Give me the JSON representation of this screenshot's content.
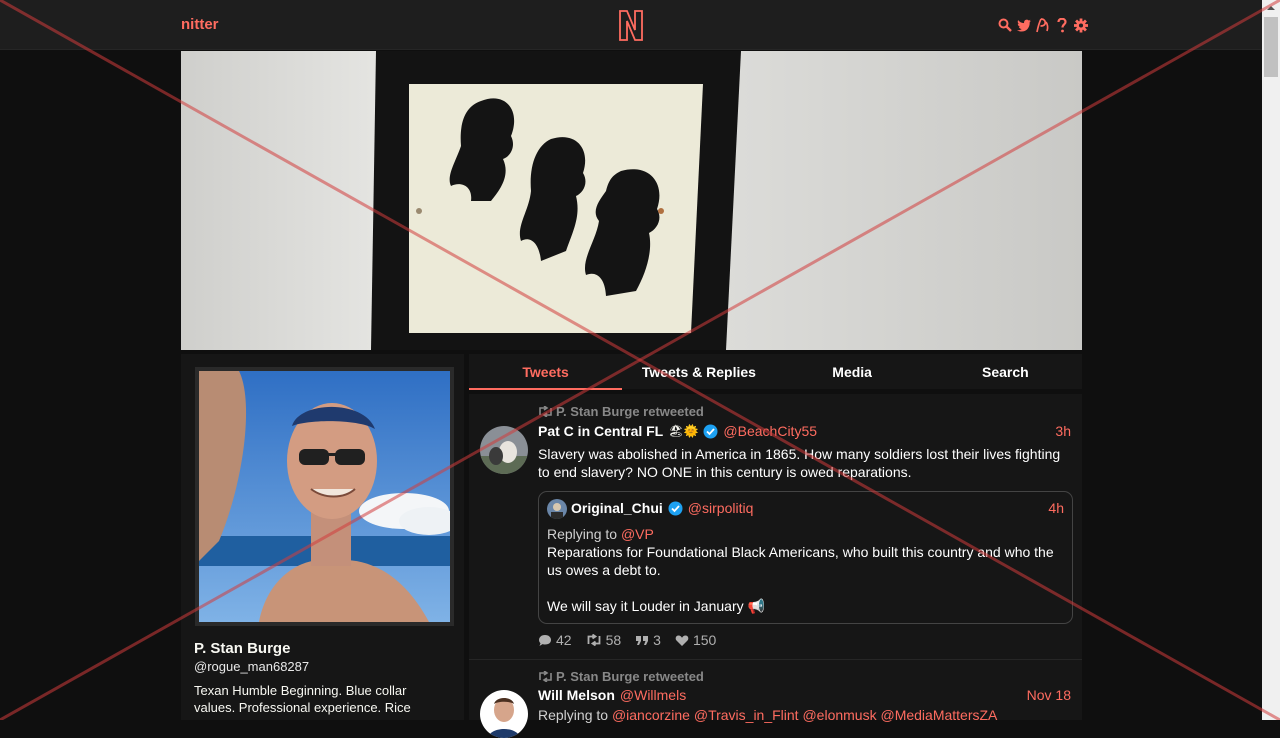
{
  "app": {
    "brand": "nitter"
  },
  "nav": {
    "icons": [
      "search-icon",
      "twitter-bird-icon",
      "rss-icon",
      "help-icon",
      "settings-icon"
    ]
  },
  "profile": {
    "fullname": "P. Stan Burge",
    "username": "@rogue_man68287",
    "bio": "Texan Humble Beginning. Blue collar values. Professional experience. Rice"
  },
  "tabs": [
    {
      "label": "Tweets",
      "active": true
    },
    {
      "label": "Tweets & Replies",
      "active": false
    },
    {
      "label": "Media",
      "active": false
    },
    {
      "label": "Search",
      "active": false
    }
  ],
  "tweets": [
    {
      "retweet_header": "P. Stan Burge retweeted",
      "fullname": "Pat C in Central FL",
      "badges": "🏖🌞",
      "verified": true,
      "handle": "@BeachCity55",
      "date": "3h",
      "text": "Slavery was abolished in America in 1865. How many soldiers lost their lives fighting to end slavery? NO ONE in this century is owed reparations.",
      "quote": {
        "fullname": "Original_Chui",
        "verified": true,
        "handle": "@sirpolitiq",
        "date": "4h",
        "replying_label": "Replying to",
        "replying_to": "@VP",
        "text_lines": [
          "Reparations for Foundational Black Americans, who built this country and who the",
          "us owes a debt to.",
          "",
          "We will say it Louder in January 📢"
        ]
      },
      "stats": {
        "replies": "42",
        "retweets": "58",
        "quotes": "3",
        "likes": "150"
      }
    },
    {
      "retweet_header": "P. Stan Burge retweeted",
      "fullname": "Will Melson",
      "handle": "@Willmels",
      "date": "Nov 18",
      "replying_label": "Replying to",
      "replying_to": "@iancorzine @Travis_in_Flint @elonmusk @MediaMattersZA"
    }
  ],
  "colors": {
    "accent": "#ff6c60",
    "background": "#0f0f0f",
    "panel": "#161616",
    "topbar": "#1e1e1e",
    "overlay_cross": "#d23c3c"
  }
}
